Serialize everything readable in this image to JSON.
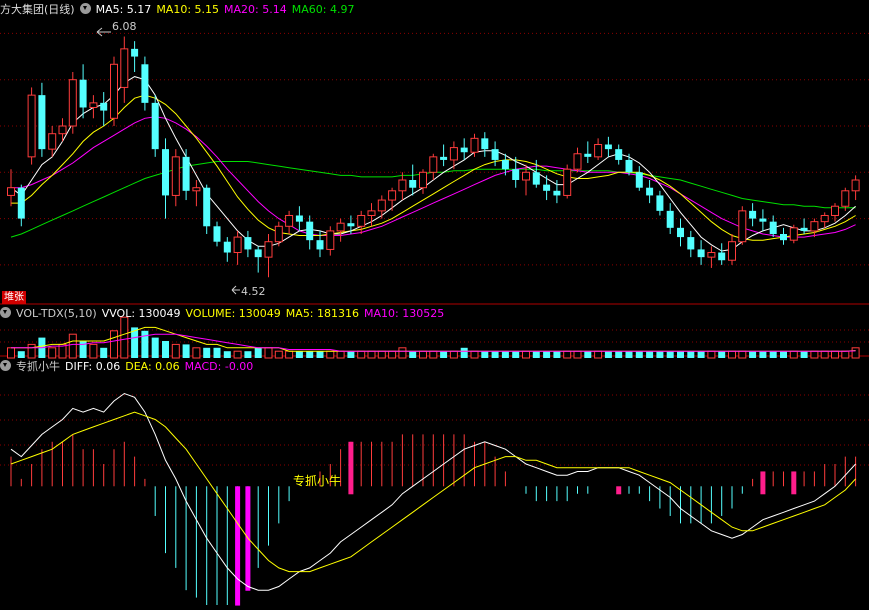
{
  "colors": {
    "up": "#ff3c3c",
    "down": "#54ffff",
    "ma5": "#ffffff",
    "ma10": "#ffff00",
    "ma20": "#ff00ff",
    "ma60": "#00e000",
    "grid": "#8b0000",
    "macd_mark": "#ff00ff",
    "text_yellow": "#ffff00"
  },
  "price_panel": {
    "title": "方大集团(日线)",
    "legend": [
      {
        "label": "MA5: 5.17",
        "color": "#ffffff"
      },
      {
        "label": "MA10: 5.15",
        "color": "#ffff00"
      },
      {
        "label": "MA20: 5.14",
        "color": "#ff00ff"
      },
      {
        "label": "MA60: 4.97",
        "color": "#00e000"
      }
    ],
    "high_label": "6.08",
    "low_label": "4.52",
    "badge": "堆张"
  },
  "volume_panel": {
    "legend": [
      {
        "label": "VOL-TDX(5,10)",
        "color": "#cccccc"
      },
      {
        "label": "VVOL: 130049",
        "color": "#ffffff"
      },
      {
        "label": "VOLUME: 130049",
        "color": "#ffff00"
      },
      {
        "label": "MA5: 181316",
        "color": "#ffff00"
      },
      {
        "label": "MA10: 130525",
        "color": "#ff00ff"
      }
    ]
  },
  "indicator_panel": {
    "legend": [
      {
        "label": "专抓小牛",
        "color": "#cccccc"
      },
      {
        "label": "DIFF: 0.06",
        "color": "#ffffff"
      },
      {
        "label": "DEA: 0.06",
        "color": "#ffff00"
      },
      {
        "label": "MACD: -0.00",
        "color": "#ff00ff"
      }
    ],
    "annotation": "专抓小牛"
  },
  "chart_data": {
    "type": "candlestick",
    "title": "方大集团(日线)",
    "ylim": [
      4.45,
      6.2
    ],
    "price_gridlines": [
      4.6,
      4.9,
      5.2,
      5.5,
      5.8,
      6.1
    ],
    "candles": [
      [
        5.05,
        5.22,
        4.98,
        5.1
      ],
      [
        5.1,
        5.12,
        4.85,
        4.9
      ],
      [
        5.3,
        5.75,
        5.25,
        5.7
      ],
      [
        5.7,
        5.78,
        5.3,
        5.35
      ],
      [
        5.35,
        5.5,
        5.3,
        5.45
      ],
      [
        5.45,
        5.55,
        5.4,
        5.5
      ],
      [
        5.5,
        5.85,
        5.45,
        5.8
      ],
      [
        5.8,
        5.9,
        5.55,
        5.62
      ],
      [
        5.62,
        5.7,
        5.55,
        5.65
      ],
      [
        5.65,
        5.72,
        5.5,
        5.6
      ],
      [
        5.55,
        5.95,
        5.5,
        5.9
      ],
      [
        5.75,
        6.08,
        5.65,
        6.0
      ],
      [
        6.0,
        6.05,
        5.85,
        5.95
      ],
      [
        5.9,
        5.95,
        5.6,
        5.65
      ],
      [
        5.65,
        5.7,
        5.3,
        5.35
      ],
      [
        5.35,
        5.42,
        4.9,
        5.05
      ],
      [
        5.05,
        5.35,
        4.98,
        5.3
      ],
      [
        5.3,
        5.35,
        5.02,
        5.08
      ],
      [
        5.08,
        5.15,
        4.98,
        5.1
      ],
      [
        5.1,
        5.12,
        4.8,
        4.85
      ],
      [
        4.85,
        4.88,
        4.72,
        4.75
      ],
      [
        4.75,
        4.78,
        4.62,
        4.68
      ],
      [
        4.68,
        4.82,
        4.6,
        4.78
      ],
      [
        4.78,
        4.82,
        4.65,
        4.7
      ],
      [
        4.7,
        4.72,
        4.55,
        4.65
      ],
      [
        4.65,
        4.8,
        4.52,
        4.75
      ],
      [
        4.75,
        4.88,
        4.72,
        4.85
      ],
      [
        4.85,
        4.95,
        4.8,
        4.92
      ],
      [
        4.92,
        4.98,
        4.82,
        4.88
      ],
      [
        4.88,
        4.92,
        4.7,
        4.76
      ],
      [
        4.76,
        4.82,
        4.65,
        4.7
      ],
      [
        4.7,
        4.85,
        4.66,
        4.82
      ],
      [
        4.82,
        4.9,
        4.75,
        4.87
      ],
      [
        4.87,
        4.92,
        4.8,
        4.85
      ],
      [
        4.85,
        4.95,
        4.8,
        4.92
      ],
      [
        4.92,
        5.0,
        4.85,
        4.95
      ],
      [
        4.95,
        5.05,
        4.9,
        5.02
      ],
      [
        5.02,
        5.1,
        4.95,
        5.08
      ],
      [
        5.08,
        5.2,
        5.02,
        5.15
      ],
      [
        5.15,
        5.25,
        5.05,
        5.1
      ],
      [
        5.1,
        5.22,
        5.06,
        5.2
      ],
      [
        5.2,
        5.32,
        5.15,
        5.3
      ],
      [
        5.3,
        5.38,
        5.24,
        5.28
      ],
      [
        5.28,
        5.4,
        5.22,
        5.36
      ],
      [
        5.36,
        5.42,
        5.28,
        5.33
      ],
      [
        5.33,
        5.45,
        5.3,
        5.42
      ],
      [
        5.42,
        5.46,
        5.3,
        5.35
      ],
      [
        5.35,
        5.4,
        5.24,
        5.28
      ],
      [
        5.28,
        5.32,
        5.18,
        5.22
      ],
      [
        5.22,
        5.3,
        5.1,
        5.15
      ],
      [
        5.15,
        5.25,
        5.05,
        5.2
      ],
      [
        5.2,
        5.28,
        5.1,
        5.12
      ],
      [
        5.12,
        5.18,
        5.02,
        5.08
      ],
      [
        5.08,
        5.15,
        5.0,
        5.05
      ],
      [
        5.05,
        5.25,
        5.03,
        5.22
      ],
      [
        5.22,
        5.36,
        5.2,
        5.32
      ],
      [
        5.32,
        5.4,
        5.26,
        5.3
      ],
      [
        5.3,
        5.42,
        5.28,
        5.38
      ],
      [
        5.38,
        5.43,
        5.3,
        5.35
      ],
      [
        5.35,
        5.38,
        5.25,
        5.28
      ],
      [
        5.28,
        5.32,
        5.18,
        5.2
      ],
      [
        5.2,
        5.24,
        5.08,
        5.1
      ],
      [
        5.1,
        5.15,
        5.0,
        5.05
      ],
      [
        5.05,
        5.08,
        4.92,
        4.95
      ],
      [
        4.95,
        5.0,
        4.8,
        4.84
      ],
      [
        4.84,
        4.9,
        4.72,
        4.78
      ],
      [
        4.78,
        4.82,
        4.65,
        4.7
      ],
      [
        4.7,
        4.76,
        4.6,
        4.65
      ],
      [
        4.65,
        4.72,
        4.58,
        4.68
      ],
      [
        4.68,
        4.74,
        4.6,
        4.63
      ],
      [
        4.63,
        4.8,
        4.6,
        4.75
      ],
      [
        4.75,
        4.98,
        4.73,
        4.95
      ],
      [
        4.95,
        5.0,
        4.85,
        4.9
      ],
      [
        4.9,
        4.96,
        4.82,
        4.88
      ],
      [
        4.88,
        4.92,
        4.78,
        4.8
      ],
      [
        4.8,
        4.84,
        4.73,
        4.76
      ],
      [
        4.76,
        4.86,
        4.74,
        4.84
      ],
      [
        4.84,
        4.9,
        4.8,
        4.82
      ],
      [
        4.82,
        4.9,
        4.78,
        4.88
      ],
      [
        4.88,
        4.94,
        4.84,
        4.92
      ],
      [
        4.92,
        5.0,
        4.88,
        4.98
      ],
      [
        4.98,
        5.1,
        4.95,
        5.08
      ],
      [
        5.08,
        5.18,
        5.02,
        5.15
      ]
    ],
    "ma5": [
      5.1,
      5.05,
      5.15,
      5.25,
      5.3,
      5.4,
      5.52,
      5.58,
      5.62,
      5.64,
      5.7,
      5.78,
      5.82,
      5.8,
      5.7,
      5.55,
      5.42,
      5.3,
      5.18,
      5.06,
      4.98,
      4.9,
      4.82,
      4.76,
      4.72,
      4.72,
      4.74,
      4.78,
      4.82,
      4.83,
      4.82,
      4.8,
      4.8,
      4.82,
      4.85,
      4.88,
      4.92,
      4.97,
      5.02,
      5.06,
      5.1,
      5.15,
      5.2,
      5.24,
      5.28,
      5.33,
      5.34,
      5.34,
      5.31,
      5.27,
      5.24,
      5.2,
      5.16,
      5.12,
      5.12,
      5.16,
      5.2,
      5.25,
      5.3,
      5.32,
      5.3,
      5.26,
      5.2,
      5.12,
      5.03,
      4.94,
      4.86,
      4.78,
      4.73,
      4.69,
      4.7,
      4.75,
      4.79,
      4.82,
      4.84,
      4.86,
      4.84,
      4.82,
      4.82,
      4.84,
      4.87,
      4.92,
      4.98
    ],
    "ma10": [
      5.0,
      5.0,
      5.05,
      5.12,
      5.18,
      5.25,
      5.32,
      5.4,
      5.46,
      5.5,
      5.55,
      5.62,
      5.68,
      5.7,
      5.68,
      5.64,
      5.58,
      5.5,
      5.42,
      5.33,
      5.24,
      5.14,
      5.04,
      4.96,
      4.89,
      4.84,
      4.81,
      4.8,
      4.79,
      4.79,
      4.79,
      4.8,
      4.81,
      4.82,
      4.83,
      4.85,
      4.87,
      4.9,
      4.94,
      4.98,
      5.02,
      5.06,
      5.1,
      5.14,
      5.18,
      5.22,
      5.25,
      5.27,
      5.28,
      5.28,
      5.27,
      5.25,
      5.22,
      5.19,
      5.17,
      5.16,
      5.16,
      5.17,
      5.18,
      5.2,
      5.2,
      5.2,
      5.18,
      5.15,
      5.11,
      5.06,
      5.0,
      4.94,
      4.88,
      4.83,
      4.79,
      4.77,
      4.76,
      4.76,
      4.77,
      4.78,
      4.79,
      4.8,
      4.81,
      4.83,
      4.85,
      4.88,
      4.92
    ],
    "ma20": [
      5.1,
      5.1,
      5.12,
      5.15,
      5.18,
      5.22,
      5.26,
      5.31,
      5.36,
      5.4,
      5.44,
      5.48,
      5.52,
      5.55,
      5.56,
      5.55,
      5.52,
      5.48,
      5.43,
      5.37,
      5.3,
      5.22,
      5.15,
      5.08,
      5.01,
      4.95,
      4.9,
      4.86,
      4.82,
      4.8,
      4.79,
      4.79,
      4.79,
      4.8,
      4.81,
      4.83,
      4.85,
      4.88,
      4.91,
      4.94,
      4.97,
      5.0,
      5.03,
      5.06,
      5.09,
      5.12,
      5.15,
      5.18,
      5.2,
      5.22,
      5.23,
      5.24,
      5.24,
      5.23,
      5.22,
      5.21,
      5.2,
      5.2,
      5.2,
      5.2,
      5.19,
      5.18,
      5.16,
      5.13,
      5.1,
      5.06,
      5.02,
      4.98,
      4.94,
      4.9,
      4.87,
      4.84,
      4.82,
      4.8,
      4.79,
      4.78,
      4.78,
      4.78,
      4.79,
      4.8,
      4.81,
      4.83,
      4.86
    ],
    "ma60": [
      4.78,
      4.8,
      4.83,
      4.86,
      4.89,
      4.92,
      4.95,
      4.98,
      5.01,
      5.04,
      5.07,
      5.1,
      5.13,
      5.16,
      5.18,
      5.2,
      5.22,
      5.24,
      5.25,
      5.26,
      5.27,
      5.27,
      5.27,
      5.27,
      5.26,
      5.25,
      5.24,
      5.23,
      5.22,
      5.21,
      5.2,
      5.19,
      5.18,
      5.18,
      5.17,
      5.17,
      5.17,
      5.17,
      5.18,
      5.18,
      5.19,
      5.2,
      5.2,
      5.21,
      5.21,
      5.22,
      5.22,
      5.22,
      5.22,
      5.22,
      5.22,
      5.22,
      5.21,
      5.21,
      5.21,
      5.21,
      5.21,
      5.21,
      5.21,
      5.2,
      5.2,
      5.19,
      5.18,
      5.17,
      5.16,
      5.15,
      5.13,
      5.11,
      5.09,
      5.07,
      5.05,
      5.03,
      5.02,
      5.01,
      5.0,
      4.99,
      4.99,
      4.98,
      4.98,
      4.97,
      4.97,
      4.97,
      4.97
    ],
    "volume": {
      "values": [
        3,
        2,
        4,
        6,
        3,
        4,
        7,
        5,
        4,
        3,
        8,
        12,
        9,
        8,
        6,
        5,
        4,
        4,
        3,
        3,
        3,
        2,
        2,
        2,
        3,
        3,
        2,
        2,
        2,
        2,
        2,
        2,
        2,
        2,
        2,
        2,
        2,
        2,
        3,
        2,
        2,
        2,
        2,
        2,
        3,
        2,
        2,
        2,
        2,
        2,
        2,
        2,
        2,
        2,
        2,
        2,
        2,
        2,
        2,
        2,
        2,
        2,
        2,
        2,
        2,
        2,
        2,
        2,
        2,
        2,
        2,
        2,
        2,
        2,
        2,
        2,
        2,
        2,
        2,
        2,
        2,
        2,
        3
      ],
      "ma5": [
        3,
        3,
        3,
        3.5,
        4,
        4,
        5,
        5,
        5,
        5,
        6,
        7,
        8,
        9,
        9,
        8,
        7,
        6,
        5,
        4,
        4,
        3,
        3,
        3,
        3,
        3,
        3,
        2,
        2,
        2,
        2,
        2,
        2,
        2,
        2,
        2,
        2,
        2,
        2,
        2,
        2,
        2,
        2,
        2,
        2,
        2,
        2,
        2,
        2,
        2,
        2,
        2,
        2,
        2,
        2,
        2,
        2,
        2,
        2,
        2,
        2,
        2,
        2,
        2,
        2,
        2,
        2,
        2,
        2,
        2,
        2,
        2,
        2,
        2,
        2,
        2,
        2,
        2,
        2,
        2,
        2,
        2,
        2.2
      ],
      "ma10": [
        3,
        3,
        3,
        3,
        3.5,
        3.5,
        4,
        4,
        4.5,
        4.5,
        5,
        5.5,
        6,
        6.5,
        7,
        7,
        7,
        6.5,
        6,
        5.5,
        5,
        4.5,
        4,
        3.5,
        3,
        3,
        3,
        2.5,
        2.5,
        2.5,
        2.5,
        2.5,
        2,
        2,
        2,
        2,
        2,
        2,
        2,
        2,
        2,
        2,
        2,
        2,
        2,
        2,
        2,
        2,
        2,
        2,
        2,
        2,
        2,
        2,
        2,
        2,
        2,
        2,
        2,
        2,
        2,
        2,
        2,
        2,
        2,
        2,
        2,
        2,
        2,
        2,
        2,
        2,
        2,
        2,
        2,
        2,
        2,
        2,
        2,
        2,
        2,
        2,
        2.1
      ]
    },
    "macd": {
      "ylim": [
        -0.32,
        0.3
      ],
      "diff": [
        0.1,
        0.08,
        0.11,
        0.14,
        0.16,
        0.18,
        0.21,
        0.2,
        0.21,
        0.2,
        0.23,
        0.25,
        0.24,
        0.2,
        0.14,
        0.07,
        0.02,
        -0.04,
        -0.09,
        -0.14,
        -0.18,
        -0.22,
        -0.25,
        -0.27,
        -0.28,
        -0.28,
        -0.27,
        -0.25,
        -0.23,
        -0.22,
        -0.2,
        -0.18,
        -0.15,
        -0.13,
        -0.11,
        -0.09,
        -0.07,
        -0.05,
        -0.02,
        0.0,
        0.02,
        0.04,
        0.06,
        0.08,
        0.1,
        0.11,
        0.12,
        0.11,
        0.1,
        0.08,
        0.06,
        0.05,
        0.04,
        0.03,
        0.03,
        0.04,
        0.04,
        0.05,
        0.05,
        0.05,
        0.04,
        0.03,
        0.01,
        -0.01,
        -0.03,
        -0.06,
        -0.08,
        -0.1,
        -0.12,
        -0.13,
        -0.14,
        -0.13,
        -0.11,
        -0.09,
        -0.08,
        -0.07,
        -0.06,
        -0.05,
        -0.04,
        -0.02,
        0.0,
        0.03,
        0.06
      ],
      "dea": [
        0.06,
        0.07,
        0.08,
        0.09,
        0.1,
        0.12,
        0.14,
        0.15,
        0.16,
        0.17,
        0.18,
        0.19,
        0.2,
        0.19,
        0.18,
        0.16,
        0.13,
        0.1,
        0.06,
        0.02,
        -0.02,
        -0.06,
        -0.1,
        -0.14,
        -0.17,
        -0.2,
        -0.22,
        -0.23,
        -0.23,
        -0.23,
        -0.22,
        -0.21,
        -0.2,
        -0.19,
        -0.17,
        -0.15,
        -0.13,
        -0.11,
        -0.09,
        -0.07,
        -0.05,
        -0.03,
        -0.01,
        0.01,
        0.03,
        0.05,
        0.06,
        0.07,
        0.08,
        0.08,
        0.07,
        0.07,
        0.06,
        0.05,
        0.05,
        0.05,
        0.05,
        0.05,
        0.05,
        0.05,
        0.05,
        0.04,
        0.03,
        0.02,
        0.01,
        -0.01,
        -0.03,
        -0.05,
        -0.07,
        -0.09,
        -0.11,
        -0.12,
        -0.12,
        -0.11,
        -0.1,
        -0.09,
        -0.08,
        -0.07,
        -0.06,
        -0.05,
        -0.03,
        -0.01,
        0.02
      ],
      "marked_bars": [
        22,
        23,
        33,
        59,
        73,
        76
      ]
    }
  }
}
